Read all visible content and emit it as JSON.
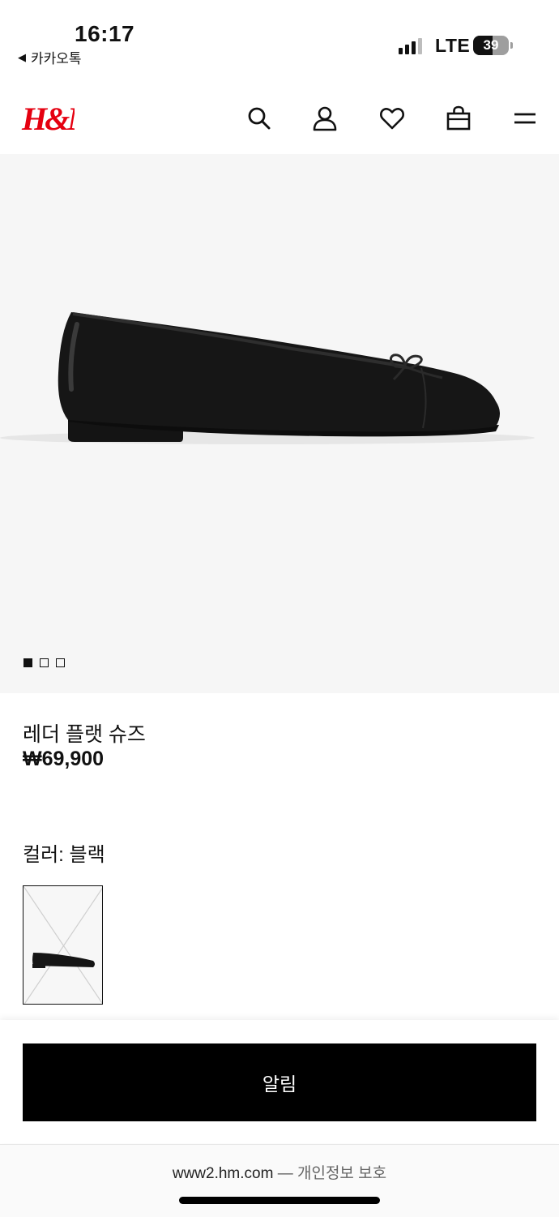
{
  "status_bar": {
    "time": "16:17",
    "back_app": "카카오톡",
    "network": "LTE",
    "battery": "39"
  },
  "header": {
    "brand": "H&M",
    "brand_color": "#e50010",
    "icons": [
      "search-icon",
      "account-icon",
      "heart-icon",
      "bag-icon",
      "menu-icon"
    ]
  },
  "product": {
    "name": "레더 플랫 슈즈",
    "price": "₩69,900",
    "color_label": "컬러: 블랙",
    "image_pages": 3,
    "image_active_page": 1
  },
  "actions": {
    "notify_label": "알림"
  },
  "browser": {
    "url": "www2.hm.com",
    "separator": "—",
    "privacy": "개인정보 보호"
  }
}
